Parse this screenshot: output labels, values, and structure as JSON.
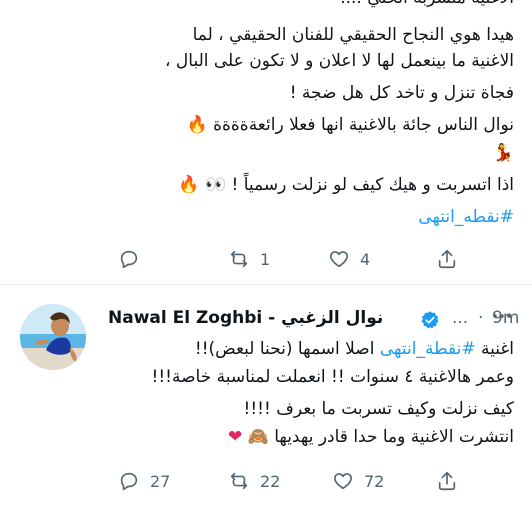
{
  "tweet1": {
    "lines": [
      "هيدا هوي النجاح الحقيقي للفنان الحقيقي ، لما",
      "الاغنية ما بينعمل لها لا اعلان و لا تكون  على البال ،",
      "فجاة تنزل و تاخد كل هل ضجة !",
      "نوال الناس جائة بالاغنية انها فعلا رائعةةةةة",
      "اذا اتسربت و هيك كيف لو نزلت رسمياً !"
    ],
    "cut_top_text": "الاغنية متسربة الحلي ....",
    "hashtag": "#نقطه_انتهى",
    "actions": {
      "reply": "",
      "retweet": "1",
      "like": "4"
    },
    "icons": [
      "fire-emoji",
      "dancer-emoji",
      "eyes-emoji",
      "fire-emoji"
    ]
  },
  "tweet2": {
    "display_name_en": "Nawal El Zoghbi",
    "separator": " - ",
    "display_name_ar": "نوال الزغبي",
    "dots": "...",
    "time": "9m",
    "line1_prefix": "اغنية ",
    "line1_hashtag": "#نقطة_انتهى",
    "line1_suffix": " اصلا اسمها (نحنا لبعض)!!",
    "line2": "وعمر هالاغنية ٤ سنوات !! انعملت لمناسبة خاصة!!!",
    "line3": "كيف نزلت وكيف تسربت ما بعرف !!!!",
    "line4": "انتشرت الاغنية وما حدا قادر يهديها",
    "actions": {
      "reply": "27",
      "retweet": "22",
      "like": "72"
    },
    "icons": [
      "verified-badge",
      "see-no-evil-monkey-emoji",
      "red-heart-emoji"
    ]
  },
  "colors": {
    "link": "#1d9bf0",
    "text": "#0f1419",
    "muted": "#536471",
    "verified": "#1d9bf0"
  }
}
